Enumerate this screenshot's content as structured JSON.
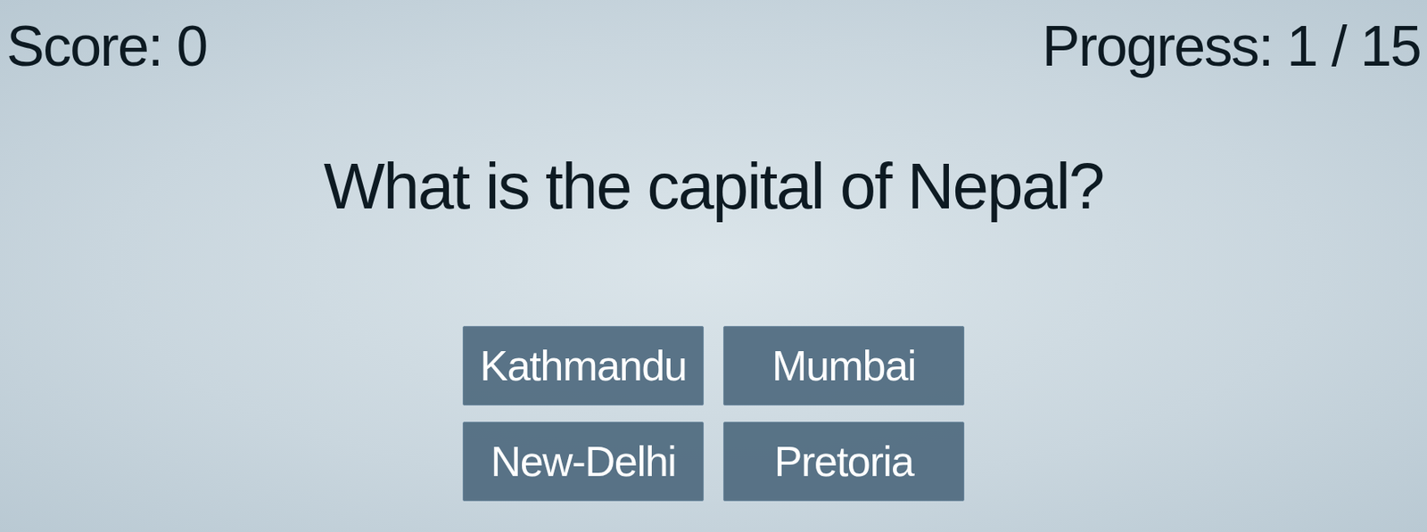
{
  "header": {
    "score": "Score: 0",
    "progress": "Progress: 1 / 15"
  },
  "question": "What is the capital of Nepal?",
  "answers": [
    "Kathmandu",
    "Mumbai",
    "New-Delhi",
    "Pretoria"
  ]
}
